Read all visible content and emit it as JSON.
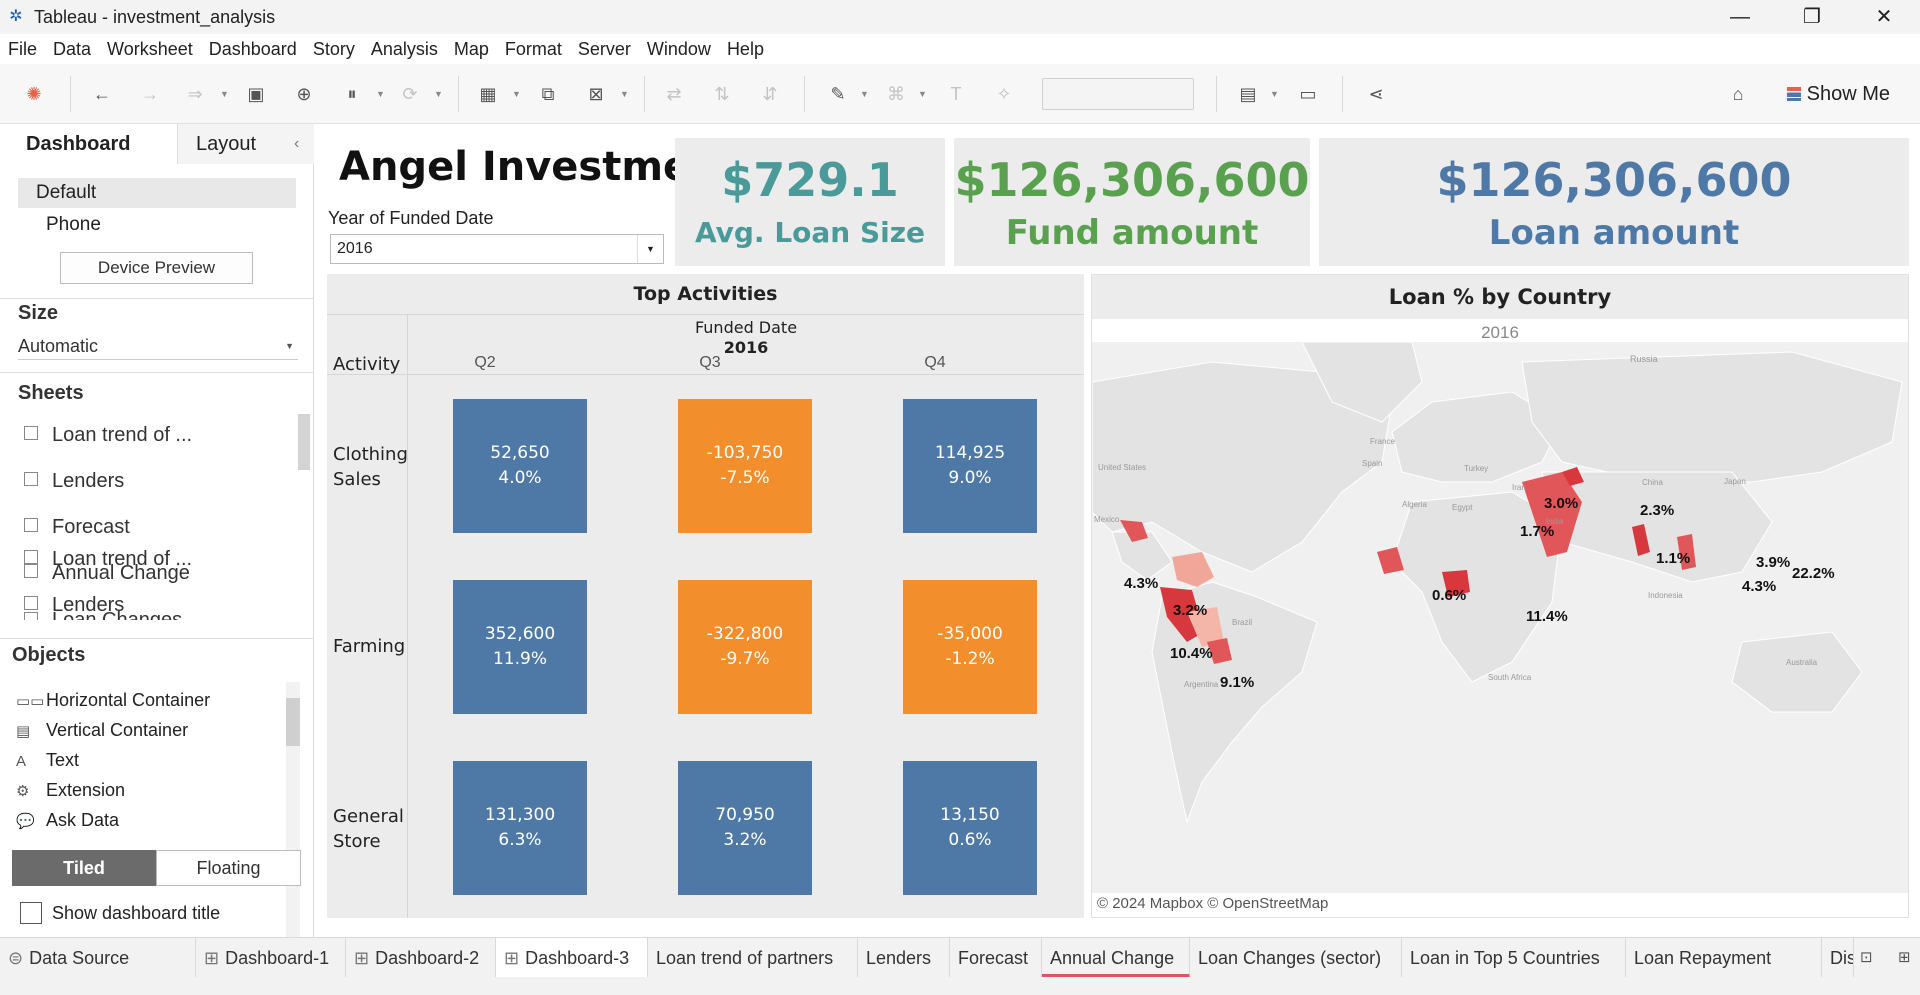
{
  "window": {
    "title": "Tableau - investment_analysis"
  },
  "menu": [
    "File",
    "Data",
    "Worksheet",
    "Dashboard",
    "Story",
    "Analysis",
    "Map",
    "Format",
    "Server",
    "Window",
    "Help"
  ],
  "toolbar": {
    "show_me": "Show Me"
  },
  "left_panel": {
    "tabs": {
      "dashboard": "Dashboard",
      "layout": "Layout"
    },
    "device": {
      "default": "Default",
      "phone": "Phone",
      "preview_button": "Device Preview"
    },
    "size": {
      "heading": "Size",
      "value": "Automatic"
    },
    "sheets": {
      "heading": "Sheets",
      "items": [
        "Loan trend of ...",
        "Lenders",
        "Forecast",
        "Annual Change",
        "Loan Changes"
      ]
    },
    "objects": {
      "heading": "Objects",
      "items": [
        "Horizontal Container",
        "Vertical Container",
        "Text",
        "Extension",
        "Ask Data"
      ]
    },
    "mode": {
      "tiled": "Tiled",
      "floating": "Floating"
    },
    "show_title": "Show dashboard title"
  },
  "dashboard": {
    "title": "Angel Investme..",
    "filter": {
      "label": "Year of Funded Date",
      "value": "2016"
    },
    "kpis": [
      {
        "value": "$729.1",
        "label": "Avg. Loan Size",
        "color": "#4a9a9a"
      },
      {
        "value": "$126,306,600",
        "label": "Fund amount",
        "color": "#59a14f"
      },
      {
        "value": "$126,306,600",
        "label": "Loan amount",
        "color": "#4e79a7"
      }
    ],
    "heatmap": {
      "title": "Top Activities",
      "row_header": "Activity",
      "col_group": "Funded Date",
      "year": "2016",
      "columns": [
        "Q2",
        "Q3",
        "Q4"
      ],
      "rows": [
        {
          "label": "Clothing Sales",
          "cells": [
            {
              "value": "52,650",
              "pct": "4.0%",
              "sign": "pos"
            },
            {
              "value": "-103,750",
              "pct": "-7.5%",
              "sign": "neg"
            },
            {
              "value": "114,925",
              "pct": "9.0%",
              "sign": "pos"
            }
          ]
        },
        {
          "label": "Farming",
          "cells": [
            {
              "value": "352,600",
              "pct": "11.9%",
              "sign": "pos"
            },
            {
              "value": "-322,800",
              "pct": "-9.7%",
              "sign": "neg"
            },
            {
              "value": "-35,000",
              "pct": "-1.2%",
              "sign": "neg"
            }
          ]
        },
        {
          "label": "General Store",
          "cells": [
            {
              "value": "131,300",
              "pct": "6.3%",
              "sign": "pos"
            },
            {
              "value": "70,950",
              "pct": "3.2%",
              "sign": "pos"
            },
            {
              "value": "13,150",
              "pct": "0.6%",
              "sign": "pos"
            }
          ]
        }
      ]
    },
    "map": {
      "title": "Loan % by Country",
      "subtitle": "2016",
      "attribution": "© 2024 Mapbox © OpenStreetMap",
      "geo_labels": [
        "Russia",
        "United States",
        "Mexico",
        "France",
        "Spain",
        "Turkey",
        "Iran",
        "Algeria",
        "Egypt",
        "China",
        "Japan",
        "India",
        "Indonesia",
        "Brazil",
        "Argentina",
        "Australia",
        "South Africa"
      ],
      "country_labels": [
        "3.0%",
        "2.3%",
        "1.7%",
        "1.1%",
        "3.9%",
        "4.3%",
        "22.2%",
        "4.3%",
        "0.6%",
        "11.4%",
        "3.2%",
        "10.4%",
        "9.1%"
      ]
    }
  },
  "tabs": [
    "Data Source",
    "Dashboard-1",
    "Dashboard-2",
    "Dashboard-3",
    "Loan trend of partners",
    "Lenders",
    "Forecast",
    "Annual Change",
    "Loan Changes (sector)",
    "Loan in Top 5 Countries",
    "Loan Repayment",
    "Dis"
  ]
}
